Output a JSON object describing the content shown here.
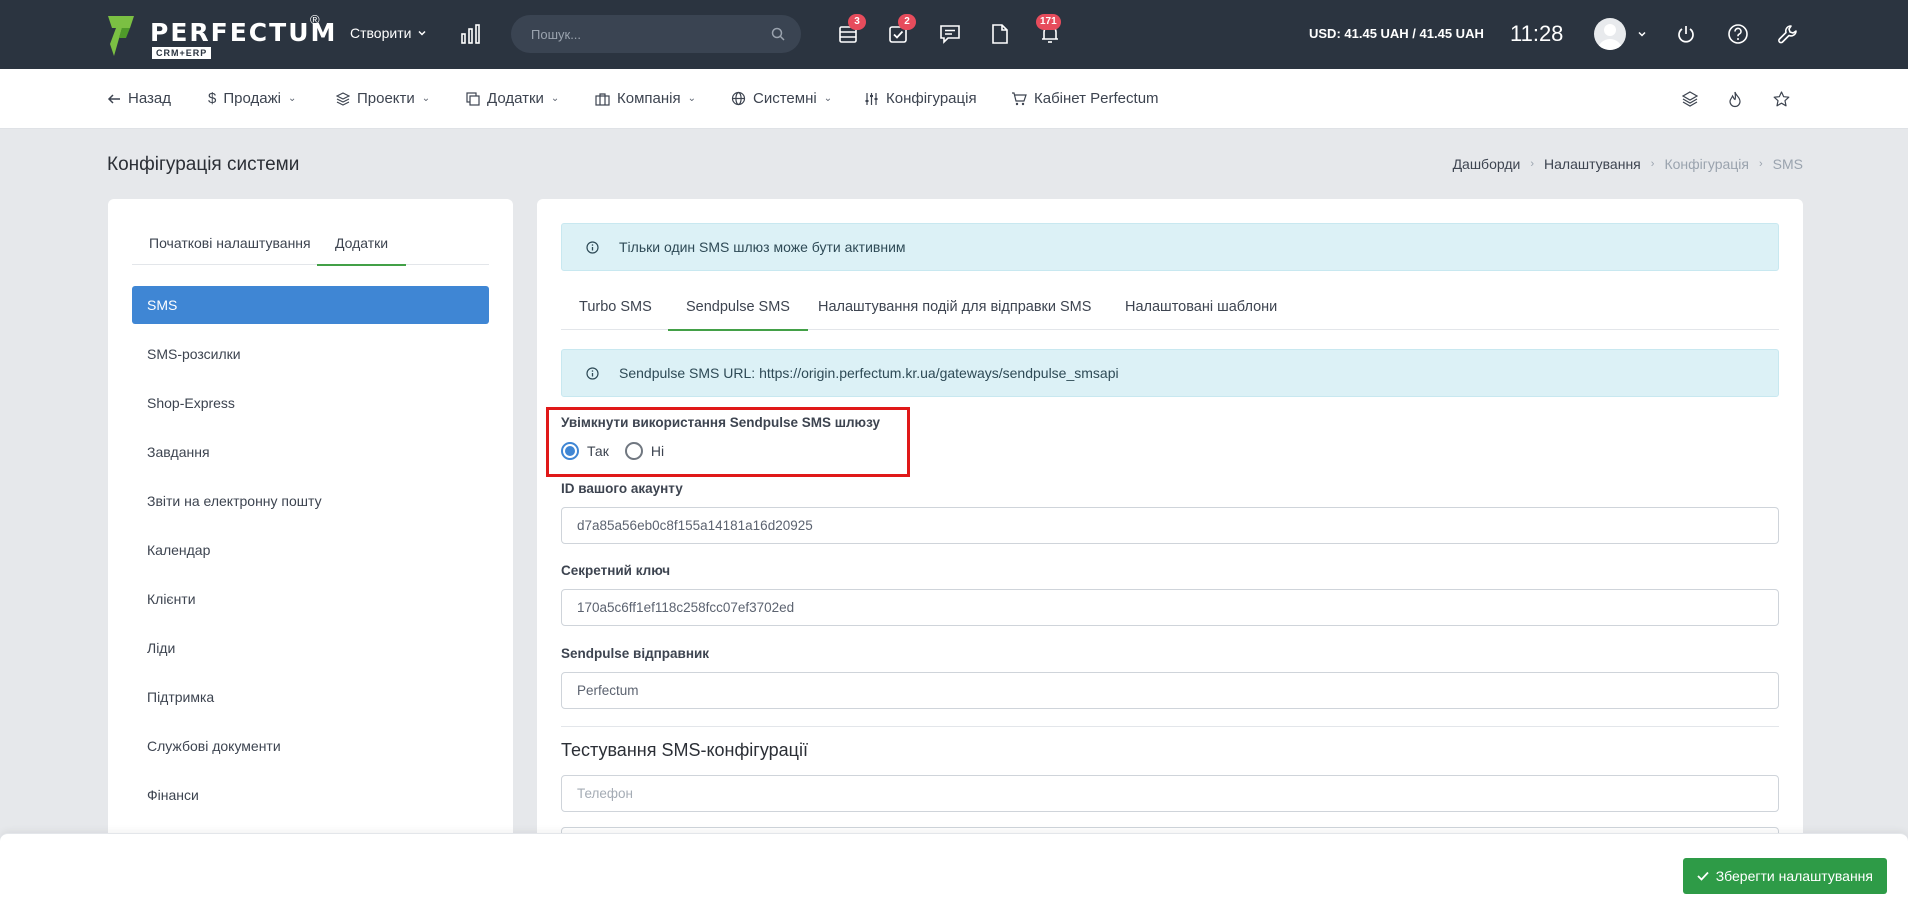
{
  "topbar": {
    "logo_text": "PERFECTUM",
    "logo_sub": "CRM+ERP",
    "logo_reg": "®",
    "create_label": "Створити",
    "search_placeholder": "Пошук...",
    "badges": {
      "tasks_board": "3",
      "checklist": "2",
      "notifications": "171"
    },
    "currency": "USD: 41.45 UAH / 41.45 UAH",
    "time": "11:28"
  },
  "nav": {
    "back": "Назад",
    "sales": "Продажі",
    "projects": "Проекти",
    "addons": "Додатки",
    "company": "Компанія",
    "system": "Системні",
    "config": "Конфігурація",
    "cabinet": "Кабінет Perfectum"
  },
  "page": {
    "title": "Конфігурація системи",
    "breadcrumb": [
      "Дашборди",
      "Налаштування",
      "Конфігурація",
      "SMS"
    ]
  },
  "left": {
    "tabs": [
      "Початкові налаштування",
      "Додатки"
    ],
    "items": [
      "SMS",
      "SMS-розсилки",
      "Shop-Express",
      "Завдання",
      "Звіти на електронну пошту",
      "Календар",
      "Клієнти",
      "Ліди",
      "Підтримка",
      "Службові документи",
      "Фінанси"
    ]
  },
  "main": {
    "alert_top": "Тільки один SMS шлюз може бути активним",
    "tabs": [
      "Turbo SMS",
      "Sendpulse SMS",
      "Налаштування подій для відправки SMS",
      "Налаштовані шаблони"
    ],
    "alert_url": "Sendpulse SMS URL: https://origin.perfectum.kr.ua/gateways/sendpulse_smsapi",
    "enable_label": "Увімкнути використання Sendpulse SMS шлюзу",
    "radio_yes": "Так",
    "radio_no": "Ні",
    "radio_selected": "Так",
    "account_label": "ID вашого акаунту",
    "account_value": "d7a85a56eb0c8f155a14181a16d20925",
    "secret_label": "Секретний ключ",
    "secret_value": "170a5c6ff1ef118c258fcc07ef3702ed",
    "sender_label": "Sendpulse відправник",
    "sender_value": "Perfectum",
    "test_title": "Тестування SMS-конфігурації",
    "phone_placeholder": "Телефон"
  },
  "footer": {
    "save_label": "Зберегти налаштування"
  },
  "colors": {
    "topbar": "#2b3440",
    "accent_blue": "#3f86d4",
    "accent_green": "#2e9b47",
    "badge_red": "#e74c5c",
    "highlight_red": "#e01818"
  }
}
